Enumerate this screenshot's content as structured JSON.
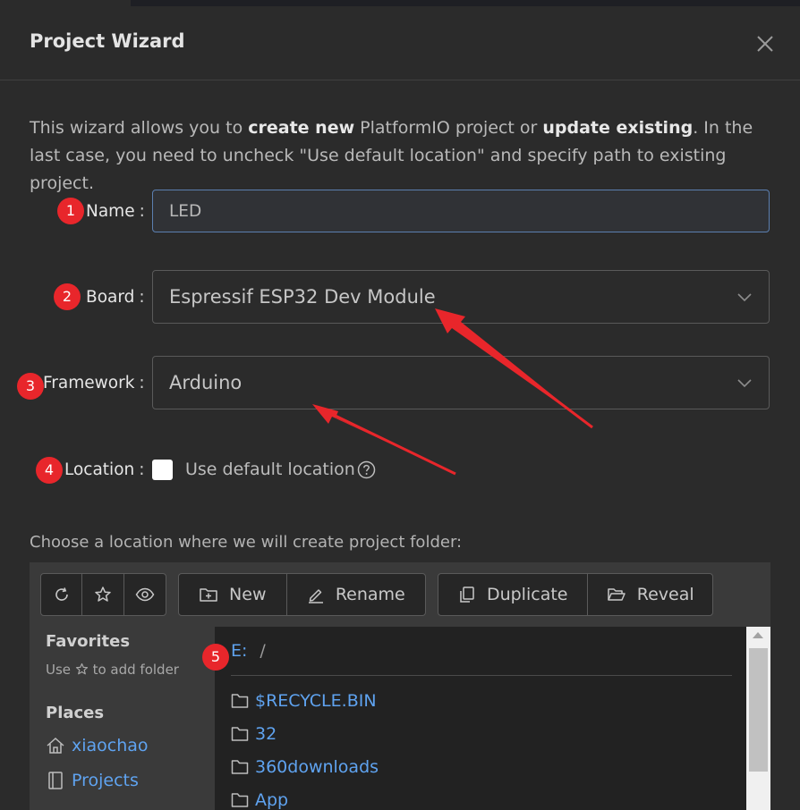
{
  "modal": {
    "title": "Project Wizard",
    "close_icon": "close-icon"
  },
  "intro": {
    "part1": "This wizard allows you to ",
    "bold1": "create new",
    "part2": " PlatformIO project or ",
    "bold2": "update existing",
    "part3": ". In the last case, you need to uncheck \"Use default location\" and specify path to existing project."
  },
  "form": {
    "name_label": "Name",
    "name_value": "LED",
    "board_label": "Board",
    "board_value": "Espressif ESP32 Dev Module",
    "framework_label": "Framework",
    "framework_value": "Arduino",
    "location_label": "Location",
    "use_default_label": "Use default location",
    "use_default_checked": false,
    "colon": ":"
  },
  "markers": [
    "1",
    "2",
    "3",
    "4",
    "5"
  ],
  "choose_location_label": "Choose a location where we will create project folder:",
  "toolbar": {
    "new_label": "New",
    "rename_label": "Rename",
    "duplicate_label": "Duplicate",
    "reveal_label": "Reveal"
  },
  "sidebar": {
    "favorites_heading": "Favorites",
    "favorites_hint_pre": "Use",
    "favorites_hint_post": "to add folder",
    "places_heading": "Places",
    "places": [
      {
        "label": "xiaochao",
        "icon": "home-icon"
      },
      {
        "label": "Projects",
        "icon": "book-icon"
      }
    ]
  },
  "browser": {
    "drive": "E:",
    "separator": "/",
    "folders": [
      "$RECYCLE.BIN",
      "32",
      "360downloads",
      "App"
    ]
  },
  "colors": {
    "accent": "#5fa3f0",
    "marker": "#e8262b",
    "arrow": "#e8262b",
    "background": "#2b2b2b"
  }
}
